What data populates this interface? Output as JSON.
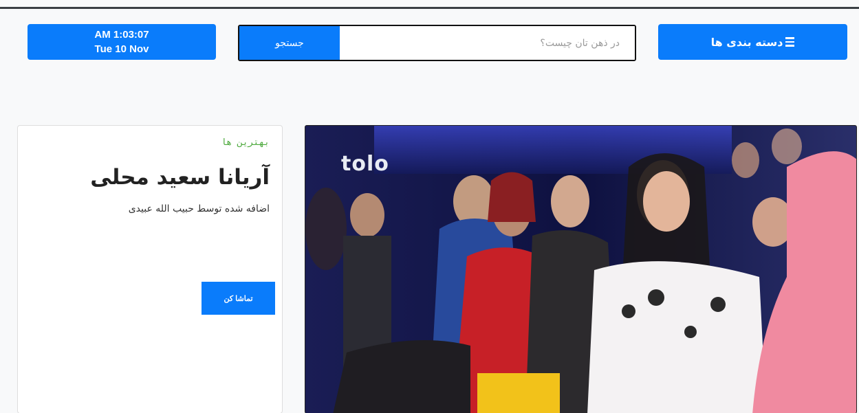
{
  "header": {
    "datetime": {
      "time": "AM 1:03:07",
      "date": "Tue 10 Nov"
    },
    "search": {
      "button_label": "جستجو",
      "placeholder": "در ذهن تان چیست؟"
    },
    "categories_label": "دسته بندی ها",
    "categories_icon": "bars-icon"
  },
  "featured": {
    "kicker": "بهترین ها",
    "title": "آریانا سعید محلی",
    "byline": "اضافه شده توسط حبیب الله عبیدی",
    "watch_label": "تماشا کن"
  },
  "video": {
    "channel_logo": "tolo"
  },
  "colors": {
    "accent": "#0a7cfb",
    "kicker": "#4aa83a",
    "page_bg": "#f8f9fa"
  }
}
